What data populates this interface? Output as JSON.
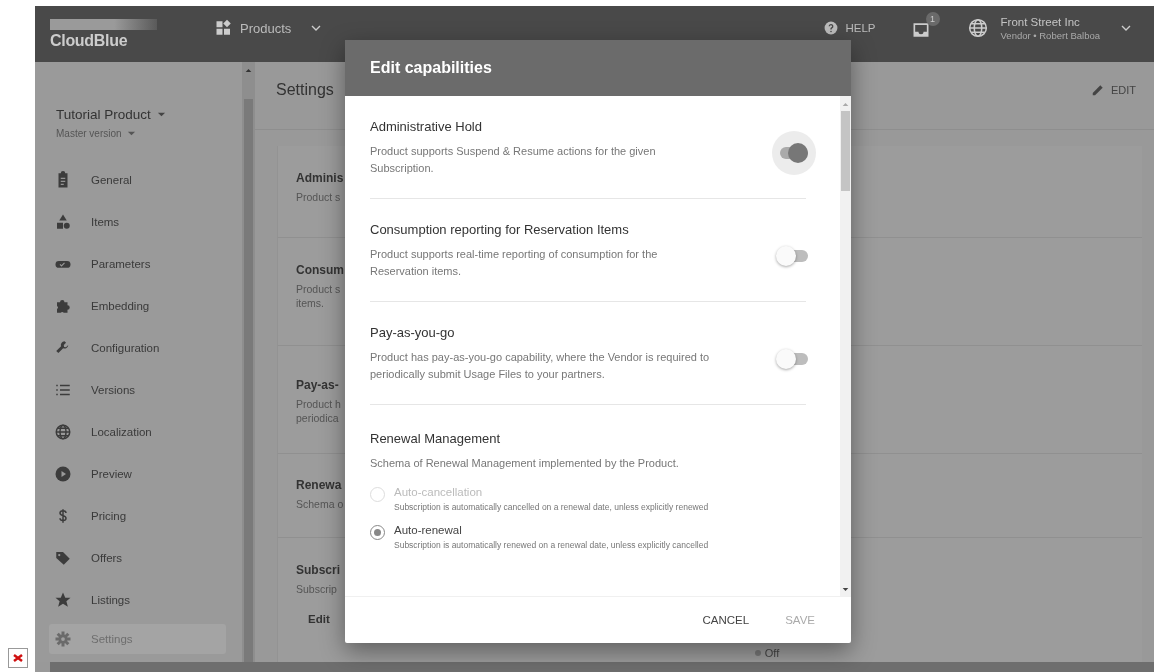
{
  "topbar": {
    "logo": "CloudBlue",
    "app_switcher": "Products",
    "help": "HELP",
    "notifications": "1",
    "account": {
      "name": "Front Street Inc",
      "role": "Vendor • Robert Balboa"
    }
  },
  "sidebar": {
    "product": "Tutorial Product",
    "version": "Master version",
    "items": [
      {
        "label": "General",
        "selected": false
      },
      {
        "label": "Items",
        "selected": false
      },
      {
        "label": "Parameters",
        "selected": false
      },
      {
        "label": "Embedding",
        "selected": false
      },
      {
        "label": "Configuration",
        "selected": false
      },
      {
        "label": "Versions",
        "selected": false
      },
      {
        "label": "Localization",
        "selected": false
      },
      {
        "label": "Preview",
        "selected": false
      },
      {
        "label": "Pricing",
        "selected": false
      },
      {
        "label": "Offers",
        "selected": false
      },
      {
        "label": "Listings",
        "selected": false
      },
      {
        "label": "Settings",
        "selected": true
      }
    ]
  },
  "page": {
    "title": "Settings",
    "edit_button": "EDIT",
    "cards": [
      {
        "title": "Adminis",
        "lines": [
          "Product s"
        ]
      },
      {
        "title": "Consum",
        "lines": [
          "Product s",
          "items."
        ]
      },
      {
        "title": "Pay-as-",
        "lines": [
          "Product h",
          "periodica"
        ]
      },
      {
        "title": "Renewa",
        "lines": [
          "Schema o"
        ]
      },
      {
        "title": "Subscri",
        "lines": [
          "Subscrip"
        ],
        "field": {
          "label": "Edit",
          "value": "Off"
        }
      }
    ]
  },
  "dialog": {
    "title": "Edit capabilities",
    "capabilities": [
      {
        "kind": "toggle",
        "title": "Administrative Hold",
        "description": "Product supports Suspend & Resume actions for the given Subscription.",
        "on": true
      },
      {
        "kind": "toggle",
        "title": "Consumption reporting for Reservation Items",
        "description": "Product supports real-time reporting of consumption for the Reservation items.",
        "on": false
      },
      {
        "kind": "toggle",
        "title": "Pay-as-you-go",
        "description": "Product has pay-as-you-go capability, where the Vendor is required to periodically submit Usage Files to your partners.",
        "on": false
      },
      {
        "kind": "radio",
        "title": "Renewal Management",
        "description": "Schema of Renewal Management implemented by the Product.",
        "options": [
          {
            "label": "Auto-cancellation",
            "description": "Subscription is automatically cancelled on a renewal date, unless explicitly renewed",
            "selected": false
          },
          {
            "label": "Auto-renewal",
            "description": "Subscription is automatically renewed on a renewal date, unless explicitly cancelled",
            "selected": true
          }
        ]
      }
    ],
    "cancel_button": "CANCEL",
    "save_button": {
      "label": "SAVE",
      "disabled": true
    }
  }
}
